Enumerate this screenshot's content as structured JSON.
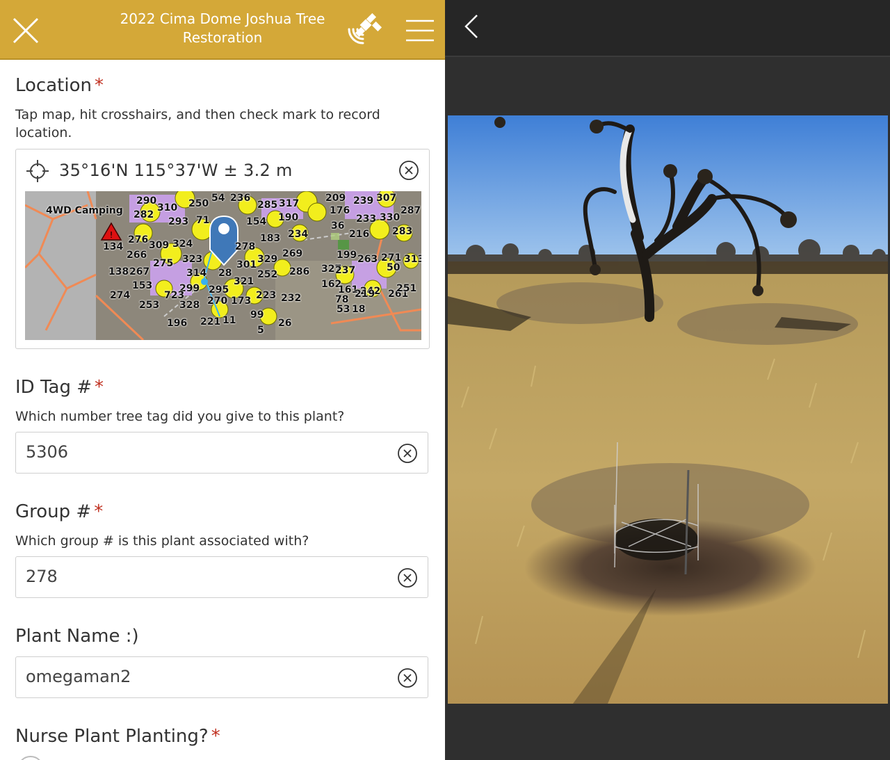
{
  "header": {
    "title": "2022 Cima Dome Joshua Tree Restoration",
    "close_icon": "close-icon",
    "gps_icon": "satellite-gps-icon",
    "menu_icon": "hamburger-menu-icon",
    "color": "#d4a838"
  },
  "location": {
    "label": "Location",
    "required": "*",
    "hint": "Tap map, hit crosshairs, and then check mark to record location.",
    "coords": "35°16'N 115°37'W ± 3.2 m",
    "map_label_camping": "4WD Camping",
    "map_numbers": [
      "290",
      "310",
      "250",
      "54",
      "236",
      "285",
      "317",
      "209",
      "239",
      "307",
      "282",
      "293",
      "71",
      "154",
      "190",
      "176",
      "233",
      "330",
      "287",
      "134",
      "276",
      "309",
      "324",
      "278",
      "183",
      "234",
      "36",
      "216",
      "283",
      "266",
      "275",
      "323",
      "301",
      "329",
      "269",
      "199",
      "263",
      "271",
      "313",
      "138",
      "267",
      "314",
      "28",
      "252",
      "286",
      "327",
      "237",
      "50",
      "153",
      "299",
      "295",
      "321",
      "162",
      "274",
      "161",
      "242",
      "261",
      "253",
      "328",
      "270",
      "173",
      "223",
      "232",
      "78",
      "219",
      "251",
      "196",
      "221",
      "11",
      "99",
      "53",
      "18",
      "5",
      "26",
      "723"
    ]
  },
  "id_tag": {
    "label": "ID Tag #",
    "required": "*",
    "hint": "Which number tree tag did you give to this plant?",
    "value": "5306"
  },
  "group": {
    "label": "Group #",
    "required": "*",
    "hint": "Which group # is this plant associated with?",
    "value": "278"
  },
  "plant_name": {
    "label": "Plant Name :)",
    "value": "omegaman2"
  },
  "nurse": {
    "label": "Nurse Plant Planting?",
    "required": "*"
  },
  "viewer": {
    "back_icon": "chevron-left-icon",
    "photo": "joshua-tree-planting-photo"
  }
}
